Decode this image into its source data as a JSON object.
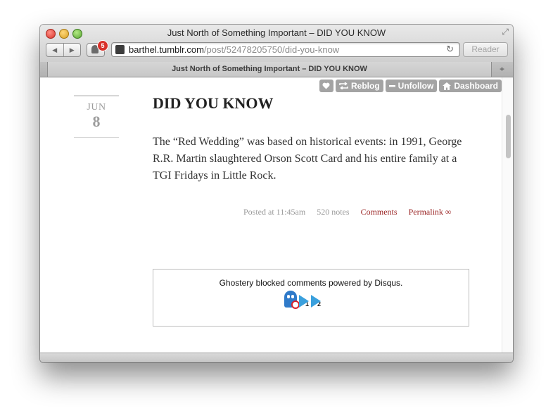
{
  "window": {
    "title": "Just North of Something Important – DID YOU KNOW",
    "tab_title": "Just North of Something Important – DID YOU KNOW"
  },
  "toolbar": {
    "back_glyph": "◀",
    "forward_glyph": "▶",
    "extension_badge": "5",
    "url_host": "barthel.tumblr.com",
    "url_path": "/post/52478205750/did-you-know",
    "reload_glyph": "↻",
    "reader_label": "Reader",
    "new_tab_glyph": "+",
    "resize_glyph": "⤢"
  },
  "tumblr_controls": {
    "reblog_label": "Reblog",
    "unfollow_label": "Unfollow",
    "dashboard_label": "Dashboard"
  },
  "post": {
    "date_month": "JUN",
    "date_day": "8",
    "title": "DID YOU KNOW",
    "body": "The “Red Wedding” was based on historical events: in 1991, George R.R. Martin slaughtered Orson Scott Card and his entire family at a TGI Fridays in Little Rock.",
    "posted_at": "Posted at 11:45am",
    "notes": "520 notes",
    "comments_label": "Comments",
    "permalink_label": "Permalink ∞"
  },
  "ghostery": {
    "message": "Ghostery blocked comments powered by Disqus.",
    "icon_num_1": "1",
    "icon_num_2": "2"
  },
  "colors": {
    "accent_link": "#9a2424",
    "tumblr_button": "#a3a3a3",
    "badge_red": "#d8312a"
  },
  "icons": [
    "heart-icon",
    "reblog-icon",
    "minus-icon",
    "home-icon",
    "ghost-icon",
    "reload-icon"
  ]
}
